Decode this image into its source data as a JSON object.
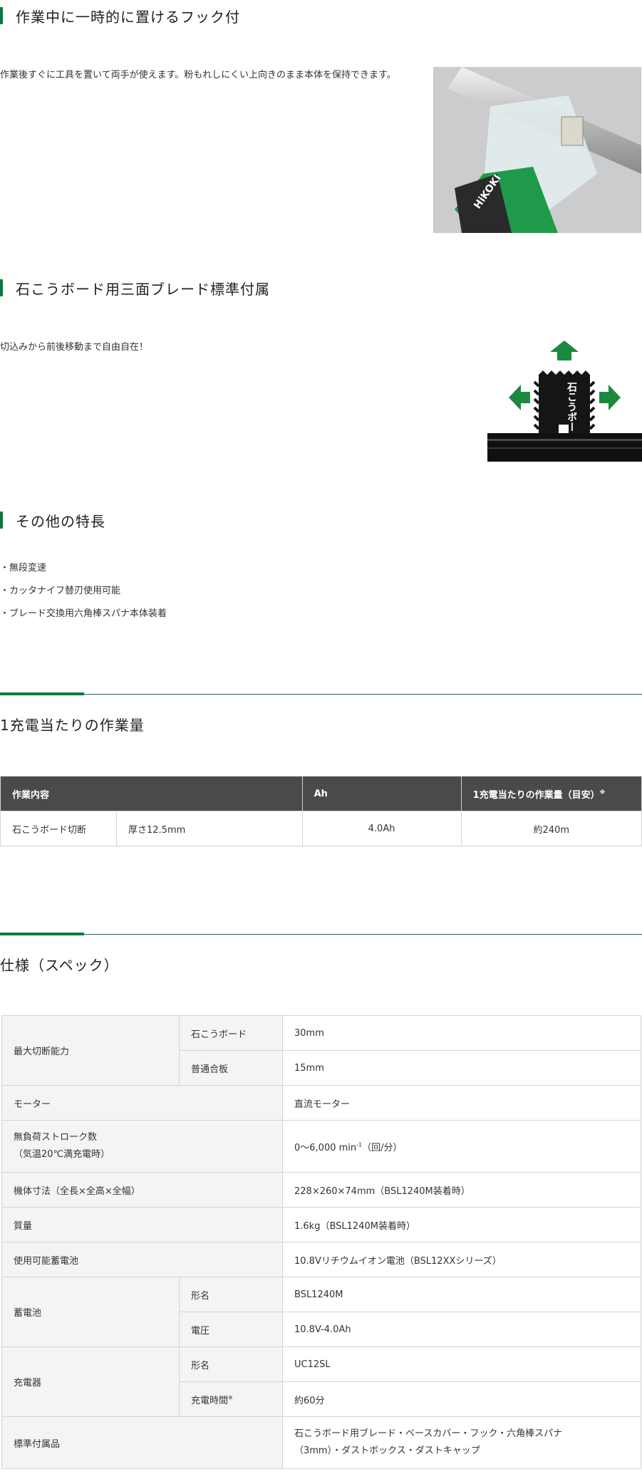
{
  "hook_section": {
    "title": "作業中に一時的に置けるフック付",
    "text": "作業後すぐに工具を置いて両手が使えます。粉もれしにくい上向きのまま本体を保持できます。"
  },
  "blade_section": {
    "title": "石こうボード用三面ブレード標準付属",
    "text": "切込みから前後移動まで自由自在！",
    "blade_label": "石こうボー"
  },
  "features_section": {
    "title": "その他の特長",
    "items": [
      "・無段変速",
      "・カッタナイフ替刃使用可能",
      "・ブレード交換用六角棒スパナ本体装着"
    ]
  },
  "work_section": {
    "title": "1充電当たりの作業量",
    "headers": [
      "作業内容",
      "Ah",
      "1充電当たりの作業量（目安）",
      "※"
    ],
    "row": [
      "石こうボード切断",
      "厚さ12.5mm",
      "4.0Ah",
      "約240m"
    ]
  },
  "spec_section": {
    "title": "仕様（スペック）",
    "max_cut": {
      "label": "最大切断能力",
      "rows": [
        {
          "sub": "石こうボード",
          "value": "30mm"
        },
        {
          "sub": "普通合板",
          "value": "15mm"
        }
      ]
    },
    "motor": {
      "label": "モーター",
      "value": "直流モーター"
    },
    "stroke": {
      "label1": "無負荷ストローク数",
      "label2": "（気温20℃満充電時）",
      "value_pre": "0～6,000 min",
      "value_sup": "-1",
      "value_post": "（回/分）"
    },
    "size": {
      "label": "機体寸法（全長×全高×全幅）",
      "value": "228×260×74mm（BSL1240M装着時）"
    },
    "weight": {
      "label": "質量",
      "value": "1.6kg（BSL1240M装着時）"
    },
    "battery_compat": {
      "label": "使用可能蓄電池",
      "value": "10.8Vリチウムイオン電池（BSL12XXシリーズ）"
    },
    "battery": {
      "label": "蓄電池",
      "rows": [
        {
          "sub": "形名",
          "value": "BSL1240M"
        },
        {
          "sub": "電圧",
          "value": "10.8V-4.0Ah"
        }
      ]
    },
    "charger": {
      "label": "充電器",
      "rows": [
        {
          "sub": "形名",
          "value": "UC12SL"
        },
        {
          "sub": "充電時間",
          "sub_mark": "※",
          "value": "約60分"
        }
      ]
    },
    "accessories": {
      "label": "標準付属品",
      "value1": "石こうボード用ブレード・ベースカバー・フック・六角棒スパナ",
      "value2": "（3mm）・ダストボックス・ダストキャップ"
    }
  },
  "colors": {
    "accent": "#0a7a3c",
    "table_header": "#4a4a4a",
    "label_bg": "#f4f4f4"
  }
}
